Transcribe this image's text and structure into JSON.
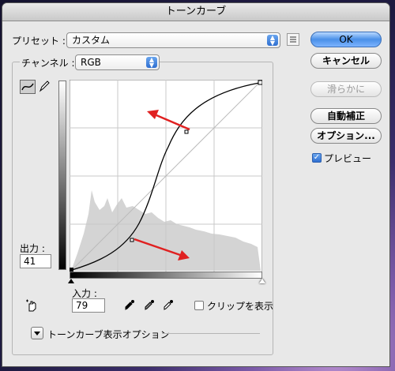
{
  "window": {
    "title": "トーンカーブ"
  },
  "preset": {
    "label": "プリセット :",
    "value": "カスタム",
    "menu_icon": "list-menu-icon"
  },
  "channel": {
    "label": "チャンネル :",
    "value": "RGB"
  },
  "output": {
    "label": "出力 :",
    "value": "41"
  },
  "input": {
    "label": "入力 :",
    "value": "79"
  },
  "buttons": {
    "ok": "OK",
    "cancel": "キャンセル",
    "smooth": "滑らかに",
    "auto": "自動補正",
    "options": "オプション..."
  },
  "preview": {
    "label": "プレビュー",
    "checked": true
  },
  "clip": {
    "label": "クリップを表示",
    "checked": false
  },
  "curve_options": {
    "label": "トーンカーブ表示オプション"
  },
  "icons": {
    "curve_tool": "curve-tool-icon",
    "pencil_tool": "pencil-tool-icon",
    "hand_tool": "target-adjust-hand-icon",
    "black_eyedropper": "black-point-eyedropper-icon",
    "gray_eyedropper": "gray-point-eyedropper-icon",
    "white_eyedropper": "white-point-eyedropper-icon"
  },
  "colors": {
    "accent": "#3d82e6",
    "annotation_arrow": "#e02020",
    "histogram": "#d0d0d0"
  }
}
